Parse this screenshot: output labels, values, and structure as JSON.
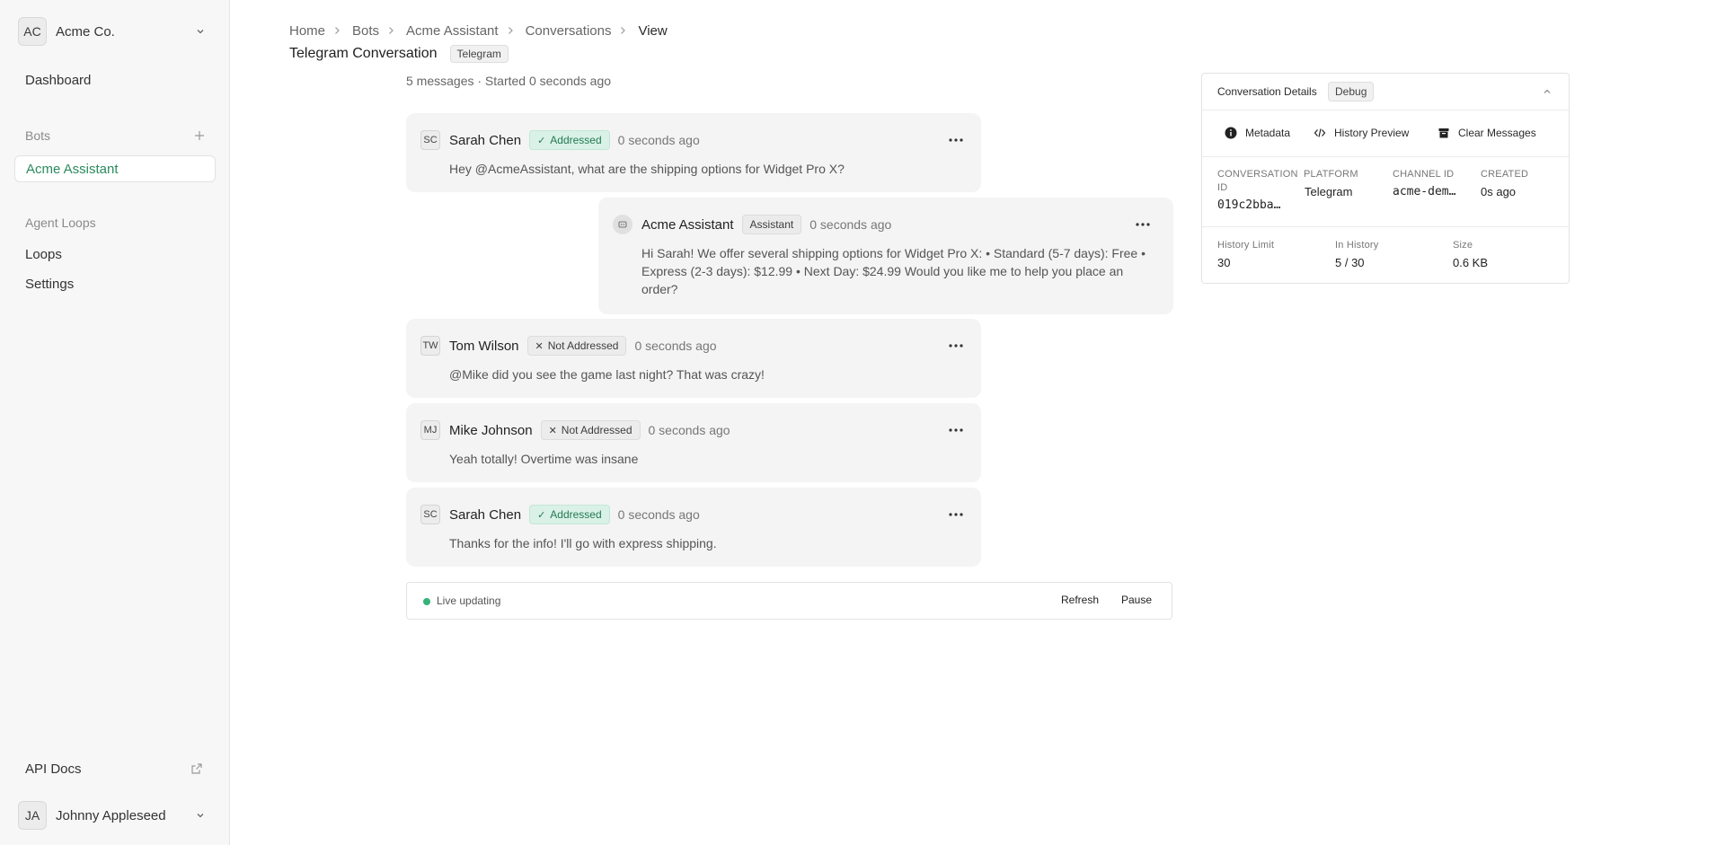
{
  "sidebar": {
    "org": {
      "initials": "AC",
      "name": "Acme Co."
    },
    "dashboard": "Dashboard",
    "bots_section": "Bots",
    "active_bot": "Acme Assistant",
    "agent_loops_section": "Agent Loops",
    "loops": "Loops",
    "settings": "Settings",
    "api_docs": "API Docs",
    "user": {
      "initials": "JA",
      "name": "Johnny Appleseed"
    }
  },
  "breadcrumb": [
    "Home",
    "Bots",
    "Acme Assistant",
    "Conversations",
    "View"
  ],
  "header": {
    "title": "Telegram Conversation",
    "platform_tag": "Telegram",
    "subline": "5 messages · Started 0 seconds ago"
  },
  "messages": [
    {
      "initials": "SC",
      "sender": "Sarah Chen",
      "badge": "Addressed",
      "time": "0 seconds ago",
      "text": "Hey @AcmeAssistant, what are the shipping options for Widget Pro X?"
    },
    {
      "initials": "",
      "sender": "Acme Assistant",
      "badge": "Assistant",
      "time": "0 seconds ago",
      "text": "Hi Sarah! We offer several shipping options for Widget Pro X: • Standard (5-7 days): Free • Express (2-3 days): $12.99 • Next Day: $24.99 Would you like me to help you place an order?"
    },
    {
      "initials": "TW",
      "sender": "Tom Wilson",
      "badge": "Not Addressed",
      "time": "0 seconds ago",
      "text": "@Mike did you see the game last night? That was crazy!"
    },
    {
      "initials": "MJ",
      "sender": "Mike Johnson",
      "badge": "Not Addressed",
      "time": "0 seconds ago",
      "text": "Yeah totally! Overtime was insane"
    },
    {
      "initials": "SC",
      "sender": "Sarah Chen",
      "badge": "Addressed",
      "time": "0 seconds ago",
      "text": "Thanks for the info! I'll go with express shipping."
    }
  ],
  "live": {
    "status": "Live updating",
    "refresh": "Refresh",
    "pause": "Pause"
  },
  "details": {
    "title": "Conversation Details",
    "debug_tag": "Debug",
    "actions": {
      "metadata": "Metadata",
      "history_preview": "History Preview",
      "clear_messages": "Clear Messages"
    },
    "fields": {
      "conversation_id_label_1": "CONVERSATION",
      "conversation_id_label_2": "ID",
      "conversation_id": "019c2bba…",
      "platform_label": "PLATFORM",
      "platform": "Telegram",
      "channel_id_label": "CHANNEL ID",
      "channel_id": "acme-dem…",
      "created_label": "CREATED",
      "created": "0s ago",
      "history_limit_label": "History Limit",
      "history_limit": "30",
      "in_history_label": "In History",
      "in_history": "5 / 30",
      "size_label": "Size",
      "size": "0.6 KB"
    }
  },
  "colors": {
    "accent": "#2b8a5f",
    "addressed_bg": "#d9f1e6",
    "live_dot": "#34b37a"
  }
}
